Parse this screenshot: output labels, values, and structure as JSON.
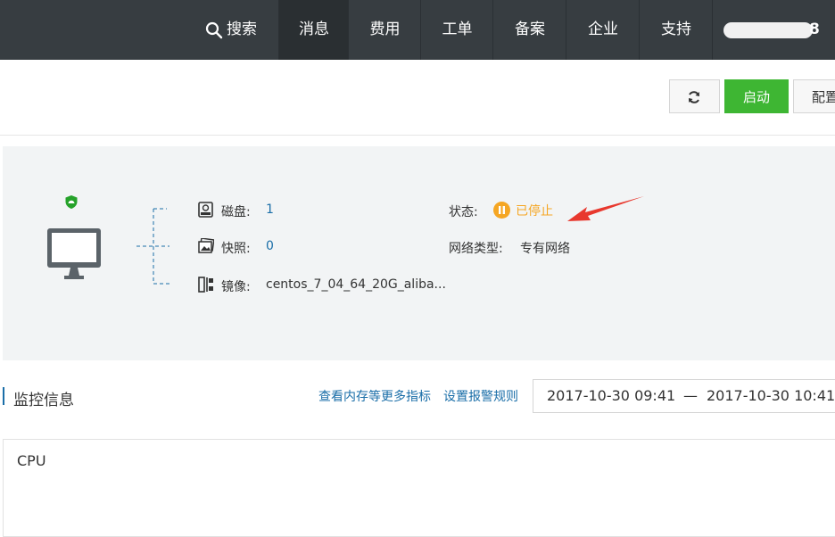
{
  "nav": {
    "search_label": "搜索",
    "items": [
      "消息",
      "费用",
      "工单",
      "备案",
      "企业",
      "支持"
    ],
    "user_suffix": "8"
  },
  "toolbar": {
    "start_label": "启动",
    "config_label": "配置"
  },
  "instance": {
    "disk_label": "磁盘:",
    "disk_value": "1",
    "snapshot_label": "快照:",
    "snapshot_value": "0",
    "image_label": "镜像:",
    "image_value": "centos_7_04_64_20G_aliba...",
    "status_label": "状态:",
    "status_value": "已停止",
    "network_label": "网络类型:",
    "network_value": "专有网络"
  },
  "monitor": {
    "title": "监控信息",
    "more_metrics_link": "查看内存等更多指标",
    "alarm_rules_link": "设置报警规则",
    "date_start": "2017-10-30 09:41",
    "date_separator": "—",
    "date_end": "2017-10-30 10:41",
    "cpu_title": "CPU"
  },
  "colors": {
    "nav_bg": "#373d41",
    "start_green": "#3eb633",
    "link_blue": "#1a6ea8",
    "status_orange": "#f5a623",
    "arrow_red": "#e8382e"
  }
}
